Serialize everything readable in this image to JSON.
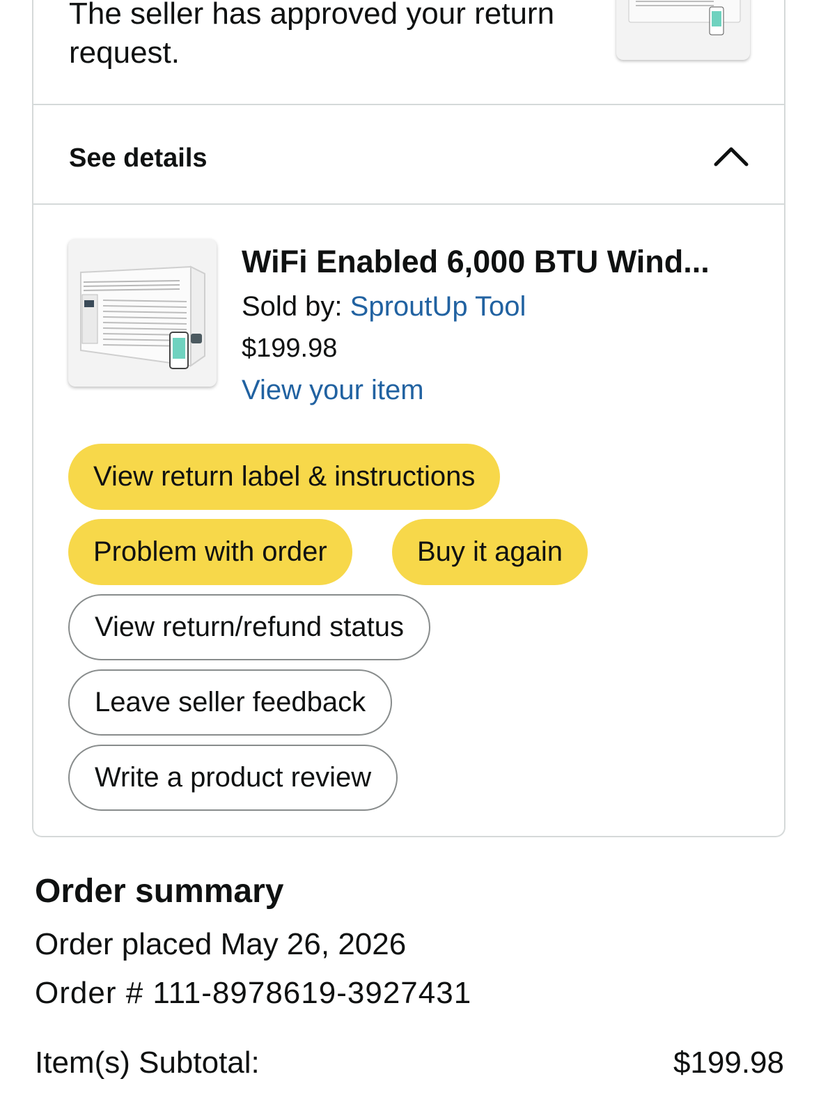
{
  "return_status": {
    "message": "The seller has approved your return request."
  },
  "details": {
    "label": "See details",
    "toggle_icon": "chevron-up-icon"
  },
  "item": {
    "title": "WiFi Enabled 6,000 BTU Wind...",
    "sold_by_label": "Sold by:",
    "seller": "SproutUp Tool",
    "price": "$199.98",
    "view_item_link": "View your item",
    "image_icon": "window-air-conditioner-image"
  },
  "actions": {
    "view_return_label": "View return label & instructions",
    "problem_with_order": "Problem with order",
    "buy_again": "Buy it again",
    "return_refund_status": "View return/refund status",
    "seller_feedback": "Leave seller feedback",
    "product_review": "Write a product review"
  },
  "summary": {
    "title": "Order summary",
    "order_placed": "Order placed May 26, 2026",
    "order_number": "Order # 111-8978619-3927431",
    "subtotal_label": "Item(s) Subtotal:",
    "subtotal_value": "$199.98"
  },
  "colors": {
    "primary_button": "#f7d84a",
    "link": "#2162a1",
    "border": "#d5d9d9"
  }
}
